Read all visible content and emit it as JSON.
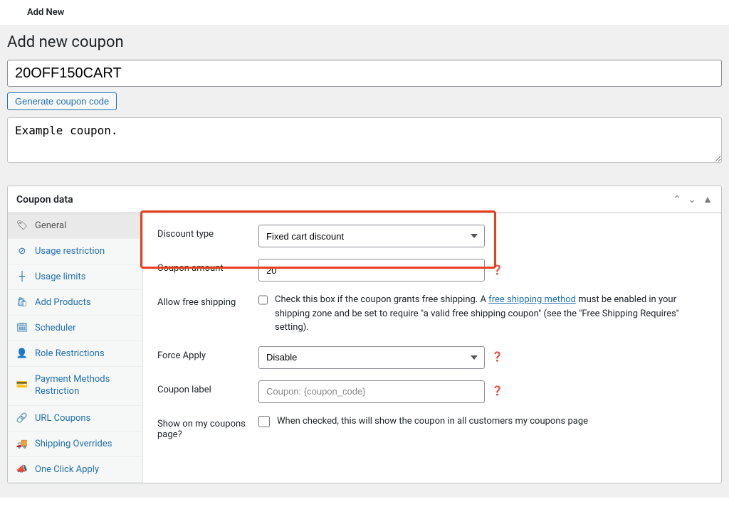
{
  "topbar": {
    "add_new": "Add New"
  },
  "page": {
    "title": "Add new coupon",
    "coupon_code": "20OFF150CART",
    "generate_btn": "Generate coupon code",
    "description": "Example coupon."
  },
  "panel": {
    "title": "Coupon data",
    "tabs": [
      {
        "id": "general",
        "label": "General"
      },
      {
        "id": "usage_restriction",
        "label": "Usage restriction"
      },
      {
        "id": "usage_limits",
        "label": "Usage limits"
      },
      {
        "id": "add_products",
        "label": "Add Products"
      },
      {
        "id": "scheduler",
        "label": "Scheduler"
      },
      {
        "id": "role_restrictions",
        "label": "Role Restrictions"
      },
      {
        "id": "payment_methods",
        "label": "Payment Methods Restriction"
      },
      {
        "id": "url_coupons",
        "label": "URL Coupons"
      },
      {
        "id": "shipping_overrides",
        "label": "Shipping Overrides"
      },
      {
        "id": "one_click_apply",
        "label": "One Click Apply"
      }
    ]
  },
  "fields": {
    "discount_type": {
      "label": "Discount type",
      "value": "Fixed cart discount"
    },
    "coupon_amount": {
      "label": "Coupon amount",
      "value": "20"
    },
    "free_shipping": {
      "label": "Allow free shipping",
      "text_before": "Check this box if the coupon grants free shipping. A ",
      "link_text": "free shipping method",
      "text_after": " must be enabled in your shipping zone and be set to require \"a valid free shipping coupon\" (see the \"Free Shipping Requires\" setting)."
    },
    "force_apply": {
      "label": "Force Apply",
      "value": "Disable"
    },
    "coupon_label": {
      "label": "Coupon label",
      "placeholder": "Coupon: {coupon_code}"
    },
    "show_my_coupons": {
      "label": "Show on my coupons page?",
      "text": "When checked, this will show the coupon in all customers my coupons page"
    }
  }
}
